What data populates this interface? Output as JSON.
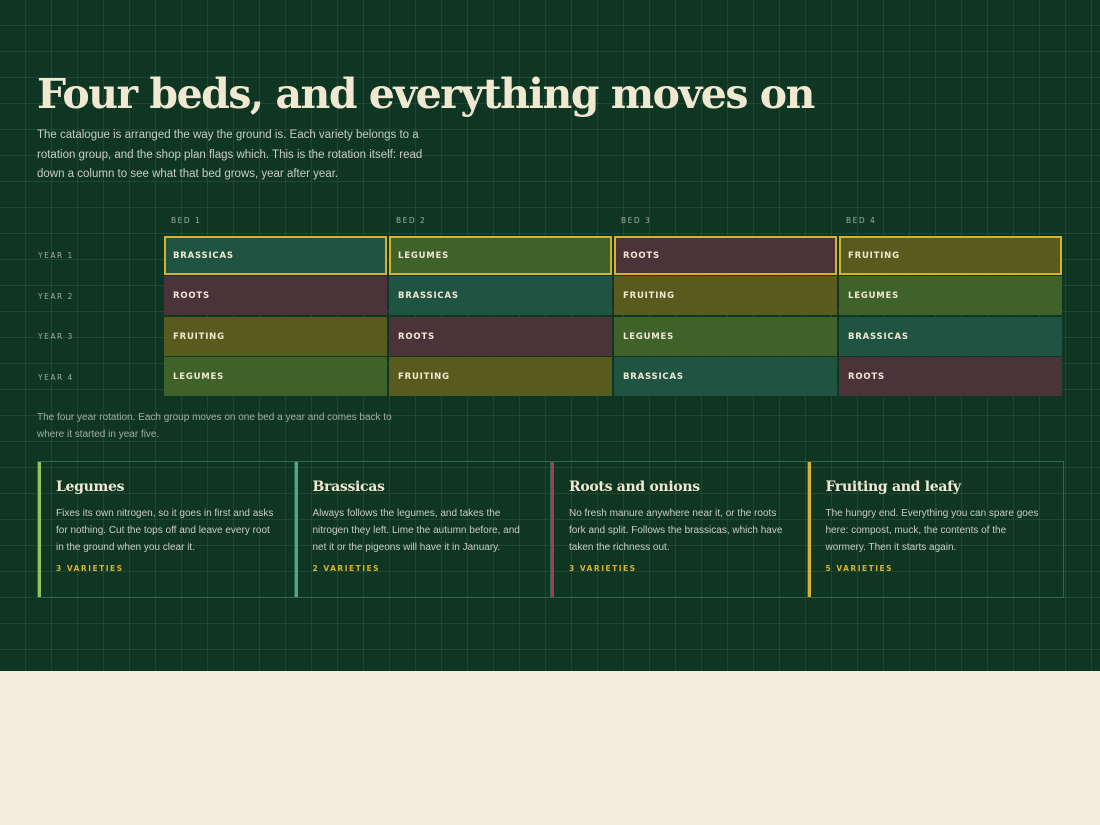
{
  "page": {
    "title": "Four beds, and everything moves on",
    "intro": "The catalogue is arranged the way the ground is. Each variety belongs to a rotation group, and the shop plan flags which. This is the rotation itself: read down a column to see what that bed grows, year after year.",
    "caption": "The four year rotation. Each group moves on one bed a year and comes back to where it started in year five."
  },
  "rotation": {
    "beds": [
      "BED 1",
      "BED 2",
      "BED 3",
      "BED 4"
    ],
    "years": [
      "YEAR 1",
      "YEAR 2",
      "YEAR 3",
      "YEAR 4"
    ],
    "current_year": "YEAR 1",
    "grid": [
      [
        "BRASSICAS",
        "LEGUMES",
        "ROOTS",
        "FRUITING"
      ],
      [
        "ROOTS",
        "BRASSICAS",
        "FRUITING",
        "LEGUMES"
      ],
      [
        "FRUITING",
        "ROOTS",
        "LEGUMES",
        "BRASSICAS"
      ],
      [
        "LEGUMES",
        "FRUITING",
        "BRASSICAS",
        "ROOTS"
      ]
    ]
  },
  "groups": [
    {
      "name": "Legumes",
      "text": "Fixes its own nitrogen, so it goes in first and asks for nothing. Cut the tops off and leave every root in the ground when you clear it.",
      "count": "3 VARIETIES",
      "accent": "#8fc65a"
    },
    {
      "name": "Brassicas",
      "text": "Always follows the legumes, and takes the nitrogen they left. Lime the autumn before, and net it or the pigeons will have it in January.",
      "count": "2 VARIETIES",
      "accent": "#4fa48a"
    },
    {
      "name": "Roots and onions",
      "text": "No fresh manure anywhere near it, or the roots fork and split. Follows the brassicas, which have taken the richness out.",
      "count": "3 VARIETIES",
      "accent": "#b8344e"
    },
    {
      "name": "Fruiting and leafy",
      "text": "The hungry end. Everything you can spare goes here: compost, muck, the contents of the wormery. Then it starts again.",
      "count": "5 VARIETIES",
      "accent": "#d8b22c"
    }
  ],
  "colors": {
    "background": "#0f3623",
    "page": "#f4ecdc",
    "highlight": "#d8b22c",
    "BRASSICAS": "#1f5442",
    "LEGUMES": "#3f612a",
    "ROOTS": "#4a3339",
    "FRUITING": "#585a1e"
  }
}
